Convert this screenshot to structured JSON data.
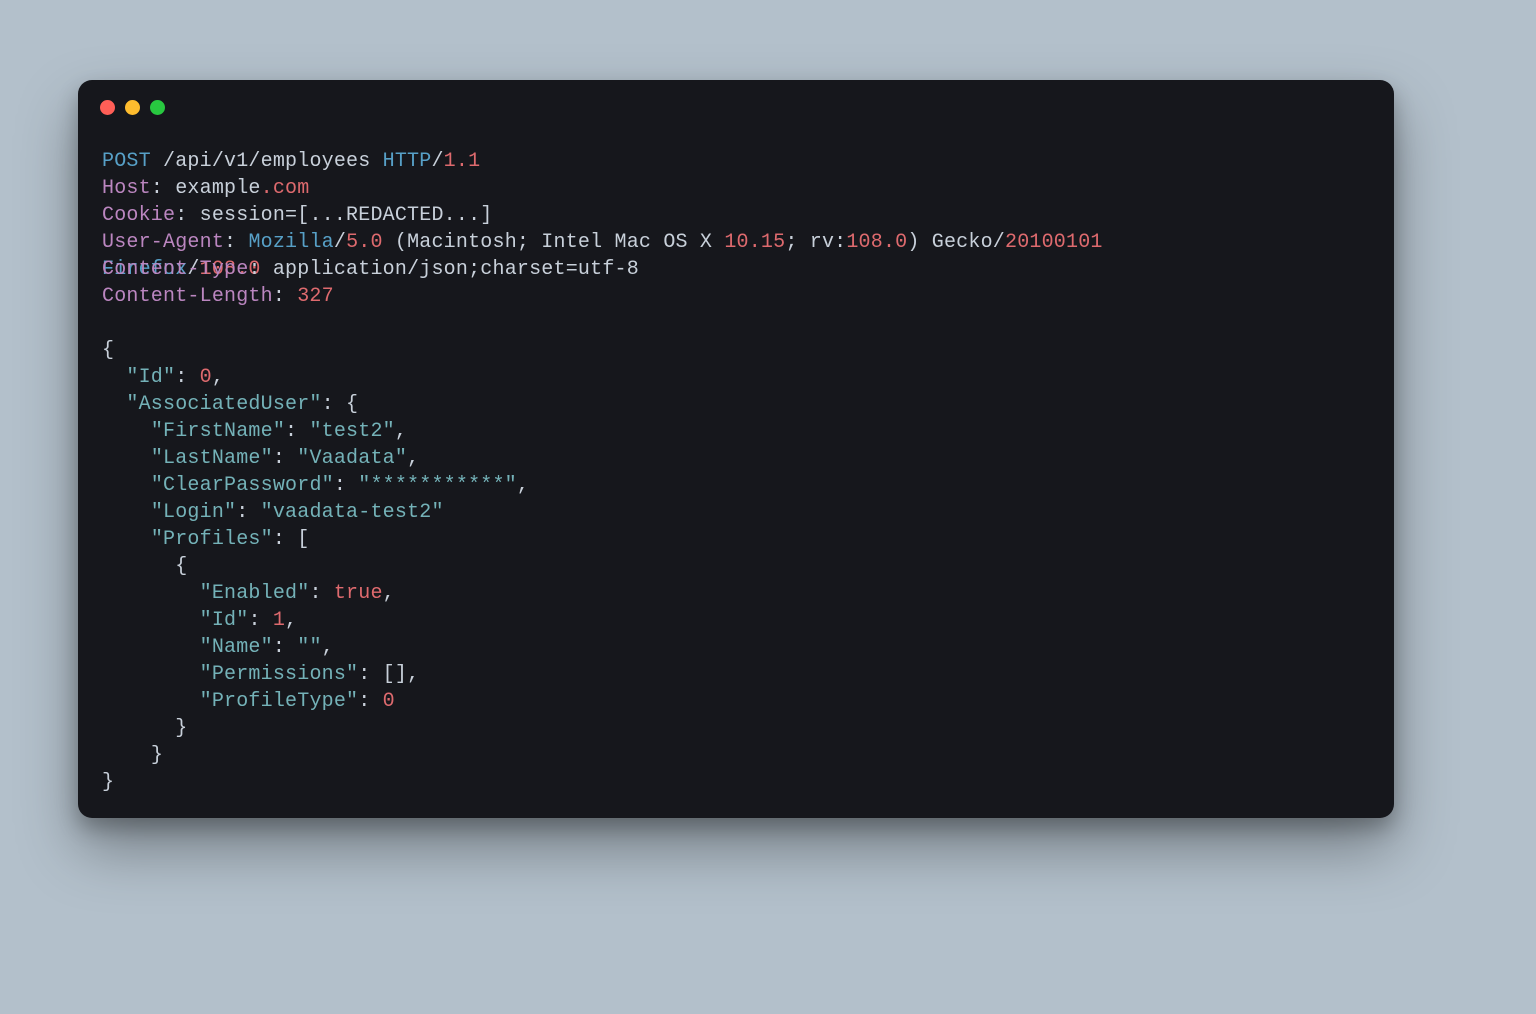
{
  "request": {
    "method": "POST",
    "path": "/api/v1/employees",
    "httpLabel": "HTTP",
    "httpVersion": "1.1",
    "headers": {
      "hostLabel": "Host",
      "hostValue": "example",
      "hostTld": ".com",
      "cookieLabel": "Cookie",
      "cookieValue": "session=[...REDACTED...]",
      "uaLabel": "User-Agent",
      "uaMozilla": "Mozilla",
      "uaVer1": "5.0",
      "uaParen": " (Macintosh; Intel Mac OS X ",
      "uaOsVer": "10.15",
      "uaRv": "; rv:",
      "uaRvVer": "108.0",
      "uaClose": ") Gecko/",
      "uaGeckoDate": "20100101",
      "uaFirefox": "Firefox",
      "uaFirefoxVer": "108.0",
      "ctLabel": "Content-Type",
      "ctValue1": "application",
      "ctValue2": "json",
      "ctTail": ";charset=utf-8",
      "clLabel": "Content-Length",
      "clValue": "327"
    },
    "body": {
      "open": "{",
      "idKey": "\"Id\"",
      "idVal": "0",
      "assocKey": "\"AssociatedUser\"",
      "firstNameKey": "\"FirstName\"",
      "firstNameVal": "\"test2\"",
      "lastNameKey": "\"LastName\"",
      "lastNameVal": "\"Vaadata\"",
      "clearPwKey": "\"ClearPassword\"",
      "clearPwVal": "\"***********\"",
      "loginKey": "\"Login\"",
      "loginVal": "\"vaadata-test2\"",
      "profilesKey": "\"Profiles\"",
      "enabledKey": "\"Enabled\"",
      "enabledVal": "true",
      "pidKey": "\"Id\"",
      "pidVal": "1",
      "nameKey": "\"Name\"",
      "nameVal": "\"\"",
      "permKey": "\"Permissions\"",
      "permVal": "[]",
      "ptypeKey": "\"ProfileType\"",
      "ptypeVal": "0",
      "close": "}"
    }
  }
}
